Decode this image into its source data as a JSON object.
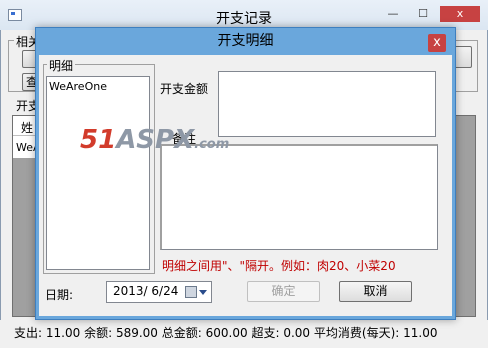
{
  "background_window": {
    "title": "开支记录",
    "minimize_glyph": "—",
    "maximize_glyph": "☐",
    "close_glyph": "x",
    "group_label": "相关",
    "section_label": "开支",
    "grid_header": "姓",
    "grid_cell": "WeA",
    "query_button_label": "查",
    "status": {
      "spent_label": "支出:",
      "spent": "11.00",
      "balance_label": "余额:",
      "balance": "589.00",
      "total_label": "总金额:",
      "total": "600.00",
      "overspend_label": "超支:",
      "overspend": "0.00",
      "avg_label": "平均消费(每天):",
      "avg": "11.00"
    }
  },
  "dialog": {
    "title": "开支明细",
    "close_glyph": "x",
    "detail_group_label": "明细",
    "detail_items": [
      "WeAreOne"
    ],
    "amount_label": "开支金额",
    "note_label": "备注",
    "hint": "明细之间用\"、\"隔开。例如：肉20、小菜20",
    "date_label": "日期:",
    "date_value": "2013/ 6/24",
    "confirm_label": "确定",
    "cancel_label": "取消"
  },
  "watermark": {
    "part1": "51",
    "part2": "ASPX",
    "part3": ".com"
  },
  "colors": {
    "dialog_frame": "#6aa7dc",
    "close_button": "#c74242",
    "hint_text": "#c00000",
    "watermark_red": "#d23b2b"
  }
}
